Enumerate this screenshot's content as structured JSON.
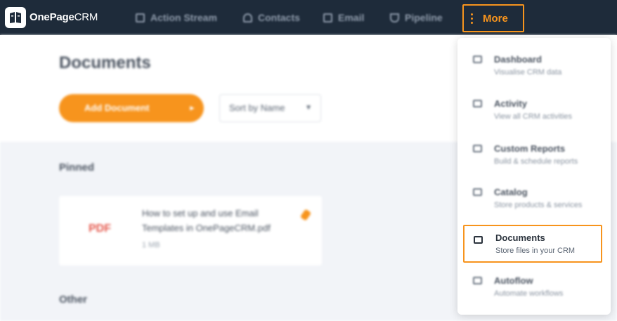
{
  "app": {
    "brand_bold": "OnePage",
    "brand_regular": "CRM",
    "accent_color": "#f7941d",
    "nav_background": "#1e2b3a"
  },
  "nav": {
    "action_stream": "Action Stream",
    "contacts": "Contacts",
    "email": "Email",
    "pipeline": "Pipeline",
    "more": "More"
  },
  "page": {
    "title": "Documents",
    "add_button": "Add Document",
    "sort_label": "Sort by Name",
    "pinned_heading": "Pinned",
    "other_heading": "Other"
  },
  "pinned_doc": {
    "type": "PDF",
    "name": "How to set up and use Email Templates in OnePageCRM.pdf",
    "size": "1 MB"
  },
  "more_menu": {
    "dashboard": {
      "title": "Dashboard",
      "subtitle": "Visualise CRM data"
    },
    "activity": {
      "title": "Activity",
      "subtitle": "View all CRM activities"
    },
    "custom_reports": {
      "title": "Custom Reports",
      "subtitle": "Build & schedule reports"
    },
    "catalog": {
      "title": "Catalog",
      "subtitle": "Store products & services"
    },
    "documents": {
      "title": "Documents",
      "subtitle": "Store files in your CRM"
    },
    "autoflow": {
      "title": "Autoflow",
      "subtitle": "Automate workflows"
    }
  }
}
